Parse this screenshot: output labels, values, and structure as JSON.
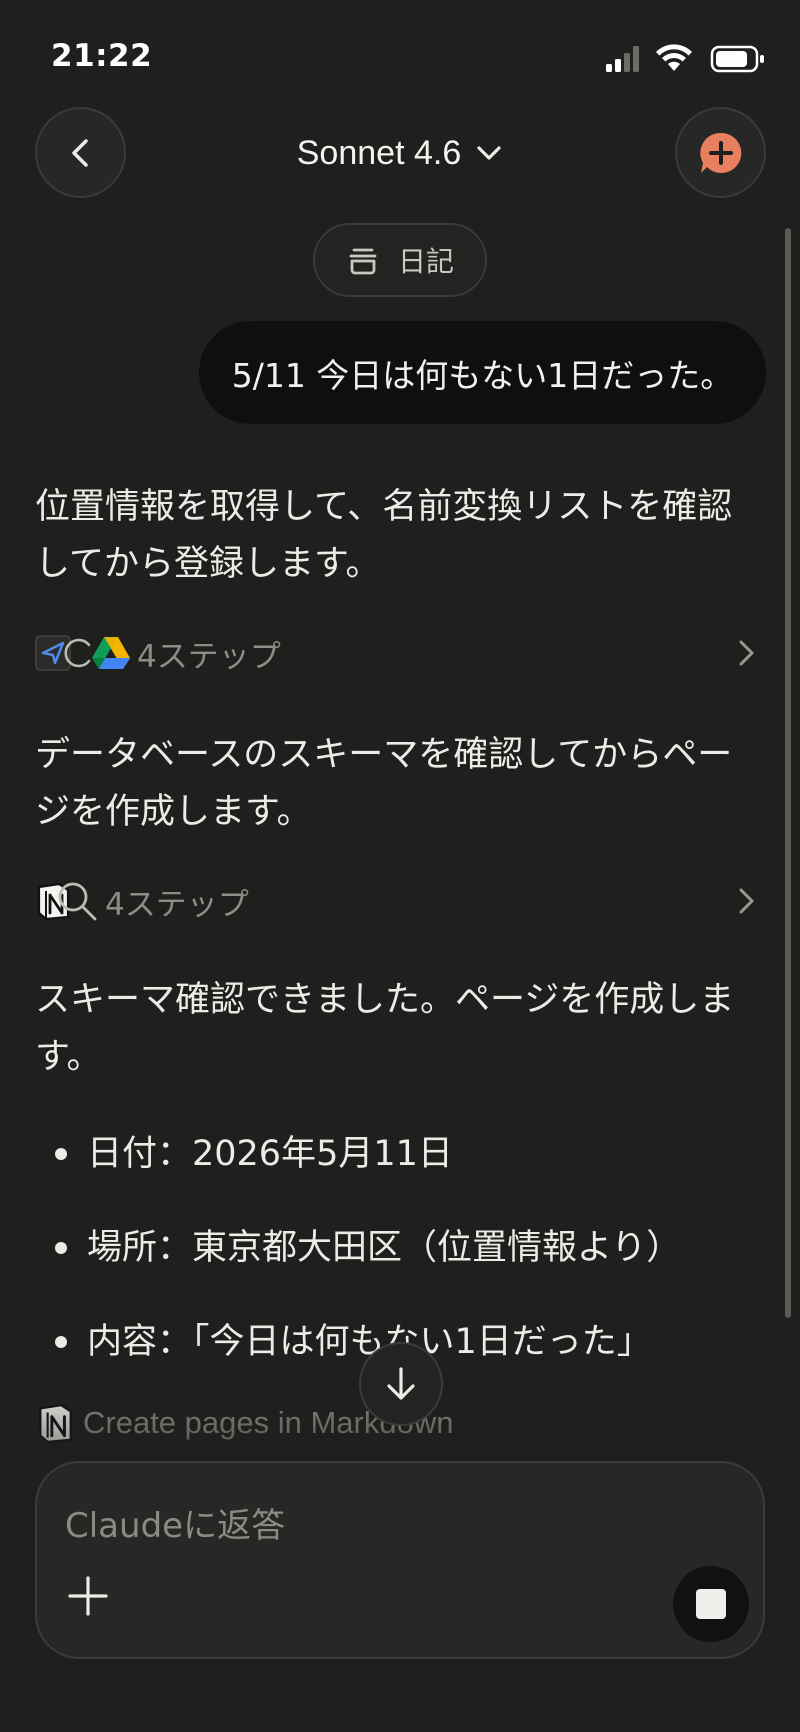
{
  "status_bar": {
    "time": "21:22"
  },
  "header": {
    "model_name": "Sonnet 4.6",
    "accent_color": "#e8805f"
  },
  "project": {
    "label": "日記"
  },
  "messages": {
    "user": "5/11 今日は何もない1日だった。",
    "assistant_1": "位置情報を取得して、名前変換リストを確認してから登録します。",
    "steps_1": "4ステップ",
    "assistant_2": "データベースのスキーマを確認してからページを作成します。",
    "steps_2": "4ステップ",
    "assistant_3": "スキーマ確認できました。ページを作成します。",
    "bullets": [
      "日付：2026年5月11日",
      "場所：東京都大田区（位置情報より）",
      "内容：「今日は何もない1日だった」"
    ],
    "tool_call": "Create pages in Markdown"
  },
  "composer": {
    "placeholder": "Claudeに返答"
  },
  "icons": {
    "back": "chevron-left-icon",
    "model_dropdown": "chevron-down-icon",
    "new_chat": "new-chat-icon",
    "project": "project-box-icon",
    "location": "location-arrow-icon",
    "drive": "google-drive-icon",
    "notion": "notion-icon",
    "search": "search-icon",
    "scroll_down": "arrow-down-icon",
    "add": "plus-icon",
    "stop": "stop-icon"
  }
}
